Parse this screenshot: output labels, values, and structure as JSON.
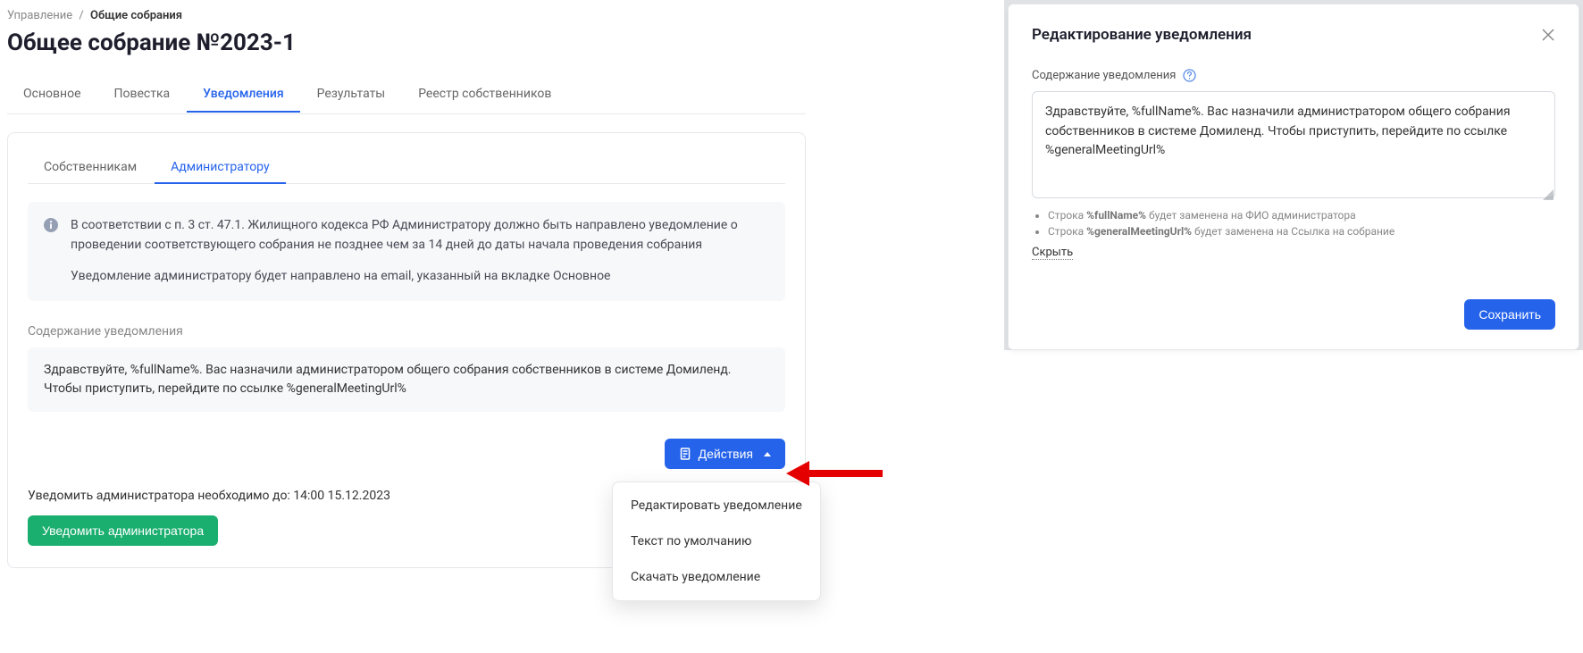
{
  "breadcrumb": {
    "root": "Управление",
    "current": "Общие собрания"
  },
  "page_title": "Общее собрание №2023-1",
  "main_tabs": [
    {
      "label": "Основное"
    },
    {
      "label": "Повестка"
    },
    {
      "label": "Уведомления"
    },
    {
      "label": "Результаты"
    },
    {
      "label": "Реестр собственников"
    }
  ],
  "inner_tabs": [
    {
      "label": "Собственникам"
    },
    {
      "label": "Администратору"
    }
  ],
  "info": {
    "p1": "В соответствии с п. 3 ст. 47.1. Жилищного кодекса РФ Администратору должно быть направлено уведомление о проведении соответствующего собрания не позднее чем за 14 дней до даты начала проведения собрания",
    "p2": "Уведомление администратору будет направлено на email, указанный на вкладке Основное"
  },
  "content_section_label": "Содержание уведомления",
  "content_text": "Здравствуйте, %fullName%. Вас назначили администратором общего собрания собственников в системе Домиленд. Чтобы приступить, перейдите по ссылке %generalMeetingUrl%",
  "actions_button": "Действия",
  "dropdown": {
    "item1": "Редактировать уведомление",
    "item2": "Текст по умолчанию",
    "item3": "Скачать уведомление"
  },
  "deadline_text": "Уведомить администратора необходимо до: 14:00 15.12.2023",
  "notify_button": "Уведомить администратора",
  "modal": {
    "title": "Редактирование уведомления",
    "field_label": "Содержание уведомления",
    "textarea_value": "Здравствуйте, %fullName%. Вас назначили администратором общего собрания собственников в системе Домиленд. Чтобы приступить, перейдите по ссылке %generalMeetingUrl%",
    "hint1_token": "%fullName%",
    "hint1_text": "Строка ",
    "hint1_suffix": " будет заменена на ФИО администратора",
    "hint2_token": "%generalMeetingUrl%",
    "hint2_text": "Строка ",
    "hint2_suffix": " будет заменена на Ссылка на собрание",
    "hide_label": "Скрыть",
    "save_button": "Сохранить"
  }
}
